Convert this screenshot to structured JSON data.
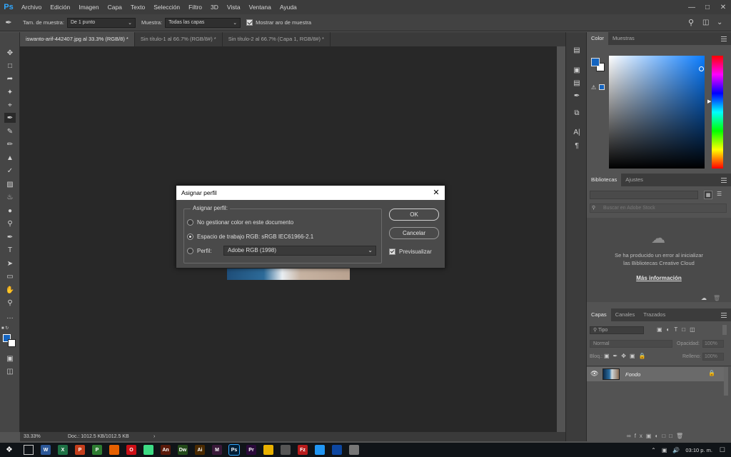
{
  "menubar": {
    "logo": "Ps",
    "items": [
      "Archivo",
      "Edición",
      "Imagen",
      "Capa",
      "Texto",
      "Selección",
      "Filtro",
      "3D",
      "Vista",
      "Ventana",
      "Ayuda"
    ]
  },
  "options": {
    "sample_size_label": "Tam. de muestra:",
    "sample_size_value": "De 1 punto",
    "sample_label": "Muestra:",
    "sample_value": "Todas las capas",
    "show_ring_label": "Mostrar aro de muestra"
  },
  "tabs": [
    {
      "label": "iswanto-arif-442407.jpg al 33.3% (RGB/8) *",
      "active": true
    },
    {
      "label": "Sin título-1 al 66.7% (RGB/8#) *",
      "active": false
    },
    {
      "label": "Sin título-2 al 66.7% (Capa 1, RGB/8#) *",
      "active": false
    }
  ],
  "status": {
    "zoom": "33.33%",
    "doc": "Doc.: 1012.5 KB/1012.5 KB",
    "arrow": "›"
  },
  "color_panel": {
    "tabs": [
      "Color",
      "Muestras"
    ],
    "foreground": "#1565c0",
    "background": "#ffffff"
  },
  "libraries_panel": {
    "tabs": [
      "Bibliotecas",
      "Ajustes"
    ],
    "search_placeholder": "Buscar en Adobe Stock",
    "error_line1": "Se ha producido un error al inicializar",
    "error_line2": "las Bibliotecas Creative Cloud",
    "more_info": "Más información"
  },
  "layers_panel": {
    "tabs": [
      "Capas",
      "Canales",
      "Trazados"
    ],
    "filter_label": "Tipo",
    "blend_mode": "Normal",
    "opacity_label": "Opacidad:",
    "opacity_value": "100%",
    "lock_label": "Bloq.:",
    "fill_label": "Relleno:",
    "fill_value": "100%",
    "layer_name": "Fondo"
  },
  "dialog": {
    "title": "Asignar perfil",
    "group_label": "Asignar perfil:",
    "option_none": "No gestionar color en este documento",
    "option_working": "Espacio de trabajo RGB: sRGB IEC61966-2.1",
    "option_profile_label": "Perfil:",
    "profile_value": "Adobe RGB (1998)",
    "ok_label": "OK",
    "cancel_label": "Cancelar",
    "preview_label": "Previsualizar"
  },
  "taskbar": {
    "time": "03:10 p. m.",
    "icons": [
      {
        "name": "word",
        "glyph": "W",
        "color": "#2b5797"
      },
      {
        "name": "excel",
        "glyph": "X",
        "color": "#1e7145"
      },
      {
        "name": "powerpoint",
        "glyph": "P",
        "color": "#c43e1c"
      },
      {
        "name": "project",
        "glyph": "P",
        "color": "#2e7d32"
      },
      {
        "name": "firefox",
        "glyph": "",
        "color": "#e66000"
      },
      {
        "name": "opera",
        "glyph": "O",
        "color": "#cc0f16"
      },
      {
        "name": "android",
        "glyph": "",
        "color": "#3ddc84"
      },
      {
        "name": "animate",
        "glyph": "An",
        "color": "#5a1a0a"
      },
      {
        "name": "dreamweaver",
        "glyph": "Dw",
        "color": "#234a1a"
      },
      {
        "name": "illustrator",
        "glyph": "Ai",
        "color": "#4a2a00"
      },
      {
        "name": "muse",
        "glyph": "M",
        "color": "#3a1a3a"
      },
      {
        "name": "photoshop",
        "glyph": "Ps",
        "color": "#001e36"
      },
      {
        "name": "premiere",
        "glyph": "Pr",
        "color": "#2a0a3a"
      },
      {
        "name": "chrome",
        "glyph": "",
        "color": "#e8b100"
      },
      {
        "name": "media",
        "glyph": "",
        "color": "#555555"
      },
      {
        "name": "filezilla",
        "glyph": "Fz",
        "color": "#b71c1c"
      },
      {
        "name": "app-blue",
        "glyph": "",
        "color": "#2196f3"
      },
      {
        "name": "app-files",
        "glyph": "",
        "color": "#0d47a1"
      },
      {
        "name": "app-misc",
        "glyph": "",
        "color": "#777777"
      }
    ]
  }
}
